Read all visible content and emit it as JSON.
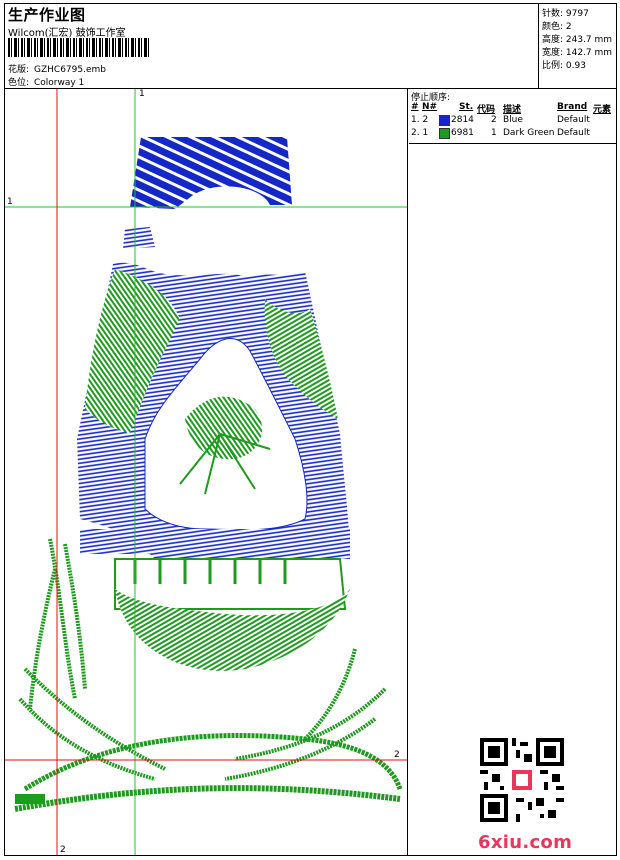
{
  "header": {
    "title": "生产作业图",
    "subtitle": "Wilcom(汇宏) 鼓饰工作室",
    "design_label": "花版:",
    "design_value": "GZHC6795.emb",
    "colorway_label": "色位:",
    "colorway_value": "Colorway 1"
  },
  "stats": {
    "stitches": "针数: 9797",
    "colors": "颜色: 2",
    "height": "高度: 243.7 mm",
    "width": "宽度: 142.7 mm",
    "scale": "比例: 0.93"
  },
  "stop_sequence": {
    "title": "停止顺序:",
    "headers": [
      "#",
      "N#",
      "St.",
      "代码",
      "描述",
      "Brand",
      "元素"
    ],
    "rows": [
      {
        "num": "1. 2",
        "color": "#1428c8",
        "st": "2814",
        "code": "2",
        "desc": "Blue",
        "brand": "Default"
      },
      {
        "num": "2. 1",
        "color": "#1e9a1e",
        "st": "6981",
        "code": "1",
        "desc": "Dark Green",
        "brand": "Default"
      }
    ]
  },
  "axes": {
    "top_label": "1",
    "left_label": "1",
    "right_label": "2",
    "bottom_label": "2"
  },
  "logo": {
    "text": "6xiu.com"
  },
  "colors": {
    "blue_thread": "#1428c8",
    "green_thread": "#1e9a1e",
    "red_axis": "#e01010",
    "green_axis": "#21c321"
  }
}
